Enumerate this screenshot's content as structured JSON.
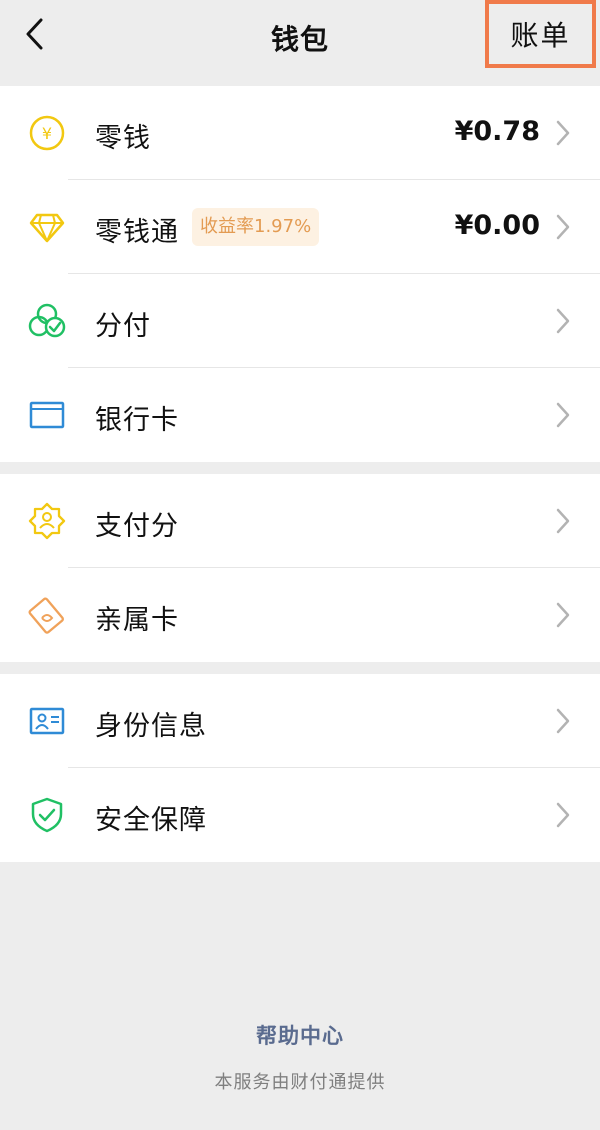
{
  "header": {
    "title": "钱包",
    "bill_label": "账单"
  },
  "groups": [
    {
      "items": [
        {
          "label": "零钱",
          "amount": "¥0.78",
          "icon": "yen-coin-icon"
        },
        {
          "label": "零钱通",
          "badge": "收益率1.97%",
          "amount": "¥0.00",
          "icon": "diamond-icon"
        },
        {
          "label": "分付",
          "icon": "cloud-check-icon"
        },
        {
          "label": "银行卡",
          "icon": "bank-card-icon"
        }
      ]
    },
    {
      "items": [
        {
          "label": "支付分",
          "icon": "badge-person-icon"
        },
        {
          "label": "亲属卡",
          "icon": "family-card-icon"
        }
      ]
    },
    {
      "items": [
        {
          "label": "身份信息",
          "icon": "id-card-icon"
        },
        {
          "label": "安全保障",
          "icon": "shield-check-icon"
        }
      ]
    }
  ],
  "footer": {
    "help_center": "帮助中心",
    "provided_by": "本服务由财付通提供"
  },
  "colors": {
    "background": "#ededed",
    "highlight_border": "#f07a4a",
    "yellow": "#f2c811",
    "green": "#20c064",
    "blue": "#2f8bd6",
    "orange": "#f0a25a",
    "badge_text": "#e39b52",
    "help_link": "#5a6b8f"
  }
}
